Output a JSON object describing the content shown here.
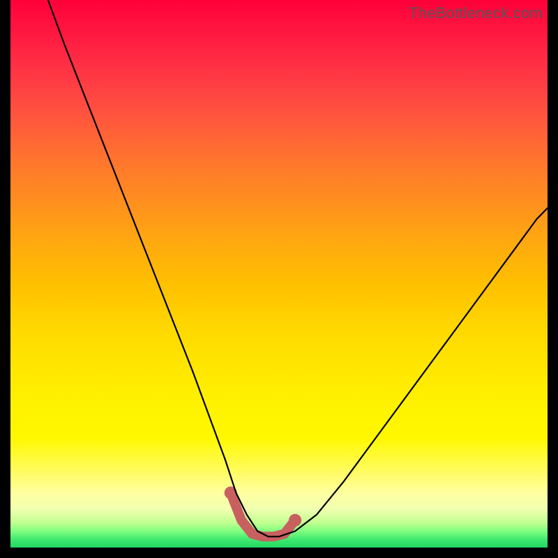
{
  "watermark": {
    "text": "TheBottleneck.com"
  },
  "chart_data": {
    "type": "line",
    "title": "",
    "xlabel": "",
    "ylabel": "",
    "xlim": [
      0,
      100
    ],
    "ylim": [
      0,
      100
    ],
    "grid": false,
    "legend": false,
    "series": [
      {
        "name": "bottleneck-curve",
        "x": [
          7,
          10,
          14,
          18,
          22,
          26,
          30,
          34,
          37,
          40,
          42,
          44,
          46,
          48,
          50,
          53,
          57,
          62,
          68,
          74,
          80,
          86,
          92,
          98,
          100
        ],
        "y": [
          100,
          92,
          82,
          72,
          62,
          52,
          42,
          32,
          24,
          16,
          10,
          6,
          3,
          2,
          2,
          3,
          6,
          12,
          20,
          28,
          36,
          44,
          52,
          60,
          62
        ]
      }
    ],
    "highlight": {
      "name": "optimal-range",
      "x": [
        41,
        43,
        45,
        47,
        49,
        51,
        53
      ],
      "y": [
        10,
        5,
        2.5,
        2,
        2,
        2.5,
        5
      ]
    },
    "colors": {
      "curve": "#000000",
      "highlight": "#c86060",
      "gradient_top": "#ff003a",
      "gradient_mid": "#ffe800",
      "gradient_bottom": "#20d860",
      "frame": "#000000"
    }
  }
}
